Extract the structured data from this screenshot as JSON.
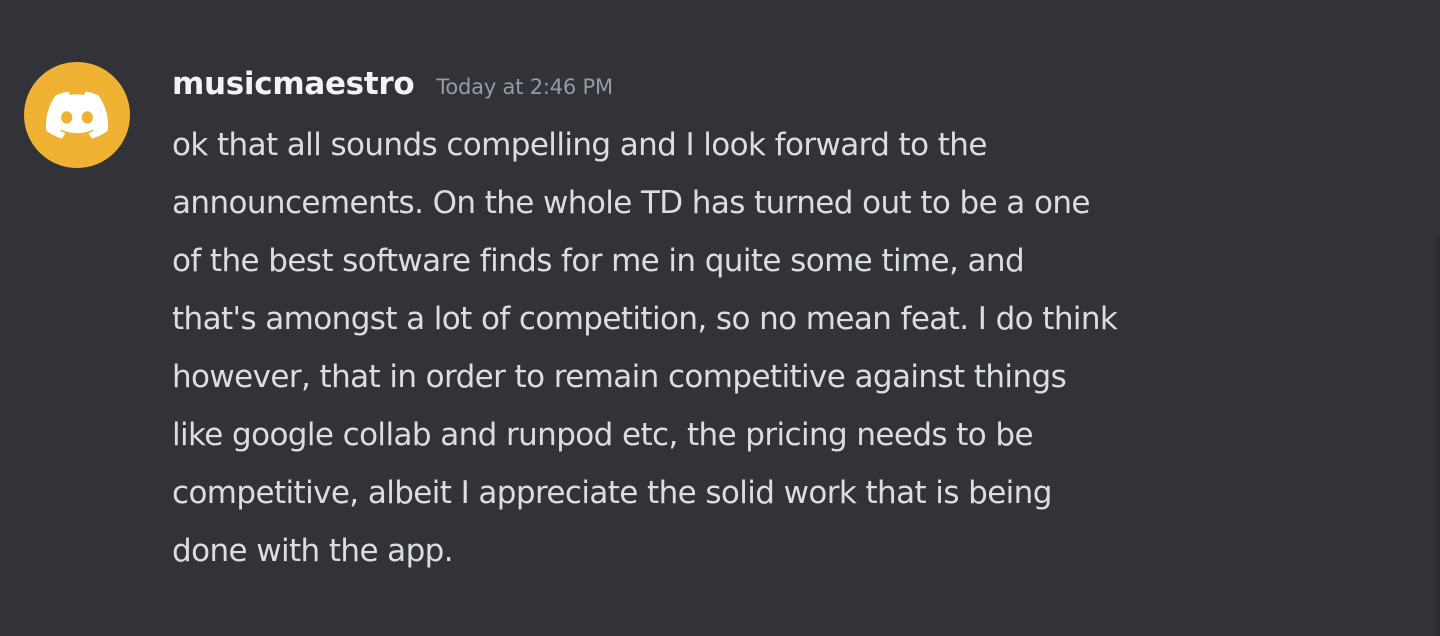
{
  "message": {
    "avatar_icon": "discord-logo-icon",
    "avatar_color": "#f0b232",
    "username": "musicmaestro",
    "timestamp": "Today at 2:46 PM",
    "lines": [
      "ok that all sounds compelling and I look forward to the",
      "announcements. On the whole TD has turned out to be a one",
      "of the best software finds for me in quite some time, and",
      "that's amongst a lot of competition, so no mean feat. I do think",
      "however, that in order to remain competitive against things",
      "like google collab and runpod etc, the pricing needs to be",
      "competitive, albeit I appreciate the solid work that is being",
      "done with the app."
    ]
  },
  "colors": {
    "background": "#313338",
    "username": "#f2f3f5",
    "timestamp": "#949ba4",
    "text": "#dbdee1"
  }
}
